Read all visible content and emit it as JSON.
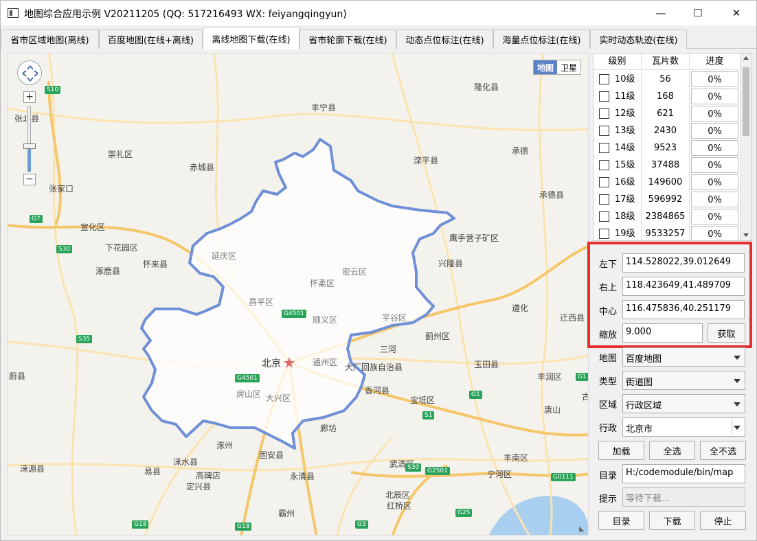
{
  "window": {
    "title": "地图综合应用示例 V20211205 (QQ: 517216493 WX: feiyangqingyun)",
    "minimize_icon": "—",
    "maximize_icon": "☐",
    "close_icon": "✕"
  },
  "tabs": [
    {
      "label": "省市区域地图(离线)"
    },
    {
      "label": "百度地图(在线+离线)"
    },
    {
      "label": "离线地图下载(在线)",
      "active": true
    },
    {
      "label": "省市轮廓下载(在线)"
    },
    {
      "label": "动态点位标注(在线)"
    },
    {
      "label": "海量点位标注(在线)"
    },
    {
      "label": "实时动态轨迹(在线)"
    }
  ],
  "map": {
    "type_buttons": {
      "map": "地图",
      "satellite": "卫星"
    },
    "zoom_in": "+",
    "zoom_out": "−",
    "capital_label": "北京",
    "place_labels": {
      "zhangbei": "张北县",
      "chongli": "崇礼区",
      "chicheng": "赤城县",
      "zhangjiakou": "张家口",
      "xuanhua": "宣化区",
      "xiahuayuan": "下花园区",
      "huailai": "怀来县",
      "zhuolu": "涿鹿县",
      "weixian": "蔚县",
      "laiyuan": "涞源县",
      "yixian": "易县",
      "laishui": "涞水县",
      "gaobeidian": "高碑店",
      "dingxing": "定兴县",
      "zhuozhou": "涿州",
      "guan": "固安县",
      "yongqing": "永清县",
      "bazhou": "霸州",
      "langfang": "廊坊",
      "xianghe": "香河县",
      "sanhe": "三河",
      "dachang": "大厂回族自治县",
      "baodi": "宝坻区",
      "wuqing": "武清区",
      "beichen": "北辰区",
      "hongqiao": "红桥区",
      "ninghe": "宁河区",
      "fengnan": "丰南区",
      "tangshan": "唐山",
      "fengrun": "丰润区",
      "yutian": "玉田县",
      "jizhou": "蓟州区",
      "zunhua": "遵化",
      "qianxi": "迁西县",
      "xinglong": "兴隆县",
      "yingshouying": "鹰手营子矿区",
      "chengde": "承德",
      "chengdexian": "承德县",
      "luanping": "滦平县",
      "fengning": "丰宁县",
      "longhua": "隆化县",
      "yanqing": "延庆区",
      "huairou": "怀柔区",
      "miyun": "密云区",
      "changping": "昌平区",
      "shunyi": "顺义区",
      "pinggu": "平谷区",
      "tongzhou": "通州区",
      "fangshan": "房山区",
      "daxing": "大兴区",
      "gu": "古"
    },
    "road_badges": {
      "s10": "S10",
      "g7": "G7",
      "s30": "S30",
      "s35": "S35",
      "g4501": "G4501",
      "g4501b": "G4501",
      "g1": "G1",
      "s1": "S1",
      "g2501": "G2501",
      "s30b": "S30",
      "g18": "G18",
      "g18b": "G18",
      "g3": "G3",
      "g25": "G25",
      "g0111": "G0111",
      "g1b": "G1"
    }
  },
  "grid": {
    "headers": [
      "级别",
      "瓦片数",
      "进度"
    ],
    "rows": [
      {
        "level": "10级",
        "tiles": "56",
        "progress": "0%"
      },
      {
        "level": "11级",
        "tiles": "168",
        "progress": "0%"
      },
      {
        "level": "12级",
        "tiles": "621",
        "progress": "0%"
      },
      {
        "level": "13级",
        "tiles": "2430",
        "progress": "0%"
      },
      {
        "level": "14级",
        "tiles": "9523",
        "progress": "0%"
      },
      {
        "level": "15级",
        "tiles": "37488",
        "progress": "0%"
      },
      {
        "level": "16级",
        "tiles": "149600",
        "progress": "0%"
      },
      {
        "level": "17级",
        "tiles": "596992",
        "progress": "0%"
      },
      {
        "level": "18级",
        "tiles": "2384865",
        "progress": "0%"
      },
      {
        "level": "19级",
        "tiles": "9533257",
        "progress": "0%"
      }
    ]
  },
  "coords": {
    "bottom_left_label": "左下",
    "bottom_left_value": "114.528022,39.012649",
    "top_right_label": "右上",
    "top_right_value": "118.423649,41.489709",
    "center_label": "中心",
    "center_value": "116.475836,40.251179",
    "zoom_label": "缩放",
    "zoom_value": "9.000",
    "fetch_button": "获取"
  },
  "settings": {
    "map_label": "地图",
    "map_value": "百度地图",
    "type_label": "类型",
    "type_value": "街道图",
    "area_label": "区域",
    "area_value": "行政区域",
    "admin_label": "行政",
    "admin_value": "北京市"
  },
  "actions": {
    "load": "加载",
    "select_all": "全选",
    "select_none": "全不选",
    "dir_label": "目录",
    "dir_value": "H:/codemodule/bin/map",
    "hint_label": "提示",
    "hint_placeholder": "等待下载...",
    "dir_button": "目录",
    "download_button": "下载",
    "stop_button": "停止"
  },
  "colors": {
    "boundary": "#6f8fd6",
    "highlight_box": "#e82d2d",
    "map_bg": "#f4f2ec",
    "highway": "#f5c76a",
    "road": "#fbe3b0",
    "water": "#a9cff0",
    "badge_green": "#29a35a"
  }
}
